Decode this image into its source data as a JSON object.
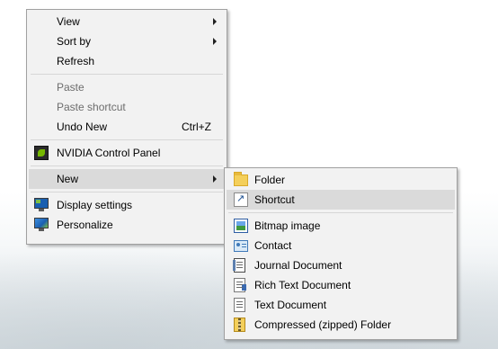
{
  "context_menu": {
    "items": [
      {
        "label": "View",
        "has_submenu": true
      },
      {
        "label": "Sort by",
        "has_submenu": true
      },
      {
        "label": "Refresh"
      },
      {
        "label": "Paste",
        "disabled": true
      },
      {
        "label": "Paste shortcut",
        "disabled": true
      },
      {
        "label": "Undo New",
        "shortcut": "Ctrl+Z"
      },
      {
        "label": "NVIDIA Control Panel",
        "icon": "nvidia-icon"
      },
      {
        "label": "New",
        "has_submenu": true,
        "highlighted": true
      },
      {
        "label": "Display settings",
        "icon": "display-settings-icon"
      },
      {
        "label": "Personalize",
        "icon": "personalize-icon"
      }
    ]
  },
  "new_submenu": {
    "items": [
      {
        "label": "Folder",
        "icon": "folder-icon"
      },
      {
        "label": "Shortcut",
        "icon": "shortcut-icon",
        "highlighted": true
      },
      {
        "label": "Bitmap image",
        "icon": "bitmap-image-icon"
      },
      {
        "label": "Contact",
        "icon": "contact-icon"
      },
      {
        "label": "Journal Document",
        "icon": "journal-document-icon"
      },
      {
        "label": "Rich Text Document",
        "icon": "rich-text-document-icon"
      },
      {
        "label": "Text Document",
        "icon": "text-document-icon"
      },
      {
        "label": "Compressed (zipped) Folder",
        "icon": "compressed-folder-icon"
      }
    ]
  },
  "colors": {
    "menu_background": "#f2f2f2",
    "menu_border": "#a0a0a0",
    "highlight": "#dadada",
    "disabled_text": "#6d6d6d",
    "separator": "#d7d7d7"
  }
}
